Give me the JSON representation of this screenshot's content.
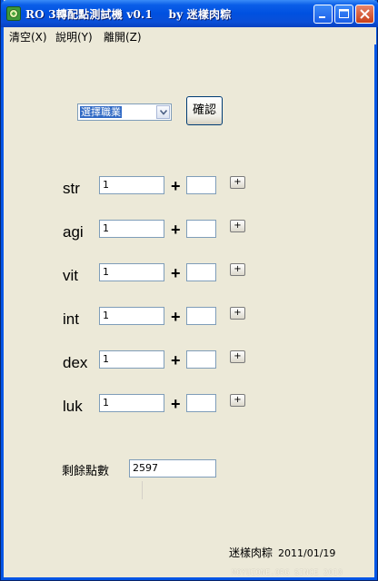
{
  "window": {
    "title": "RO 3轉配點測試機 v0.1    by 迷樣肉粽",
    "icon": "app-logo-icon"
  },
  "titlebar_buttons": {
    "minimize_icon": "minimize-icon",
    "maximize_icon": "maximize-icon",
    "close_icon": "close-icon"
  },
  "menu": [
    {
      "label": "清空(X)"
    },
    {
      "label": "說明(Y)"
    },
    {
      "label": "離開(Z)"
    }
  ],
  "job_select": {
    "value": "選擇職業"
  },
  "confirm_button": {
    "label": "確認"
  },
  "stats": [
    {
      "name": "str",
      "value": "1",
      "add": ""
    },
    {
      "name": "agi",
      "value": "1",
      "add": ""
    },
    {
      "name": "vit",
      "value": "1",
      "add": ""
    },
    {
      "name": "int",
      "value": "1",
      "add": ""
    },
    {
      "name": "dex",
      "value": "1",
      "add": ""
    },
    {
      "name": "luk",
      "value": "1",
      "add": ""
    }
  ],
  "plus_sign": "+",
  "add_button_label": "+",
  "remaining_points": {
    "label": "剩餘點數",
    "value": "2597"
  },
  "credit": {
    "author": "迷樣肉粽",
    "date": "2011/01/19"
  },
  "watermark": "MOYUZONE.ORG SINCE 2010",
  "colors": {
    "titlebar": "#0050e0",
    "face": "#ece9d8",
    "selection": "#316ac5"
  }
}
